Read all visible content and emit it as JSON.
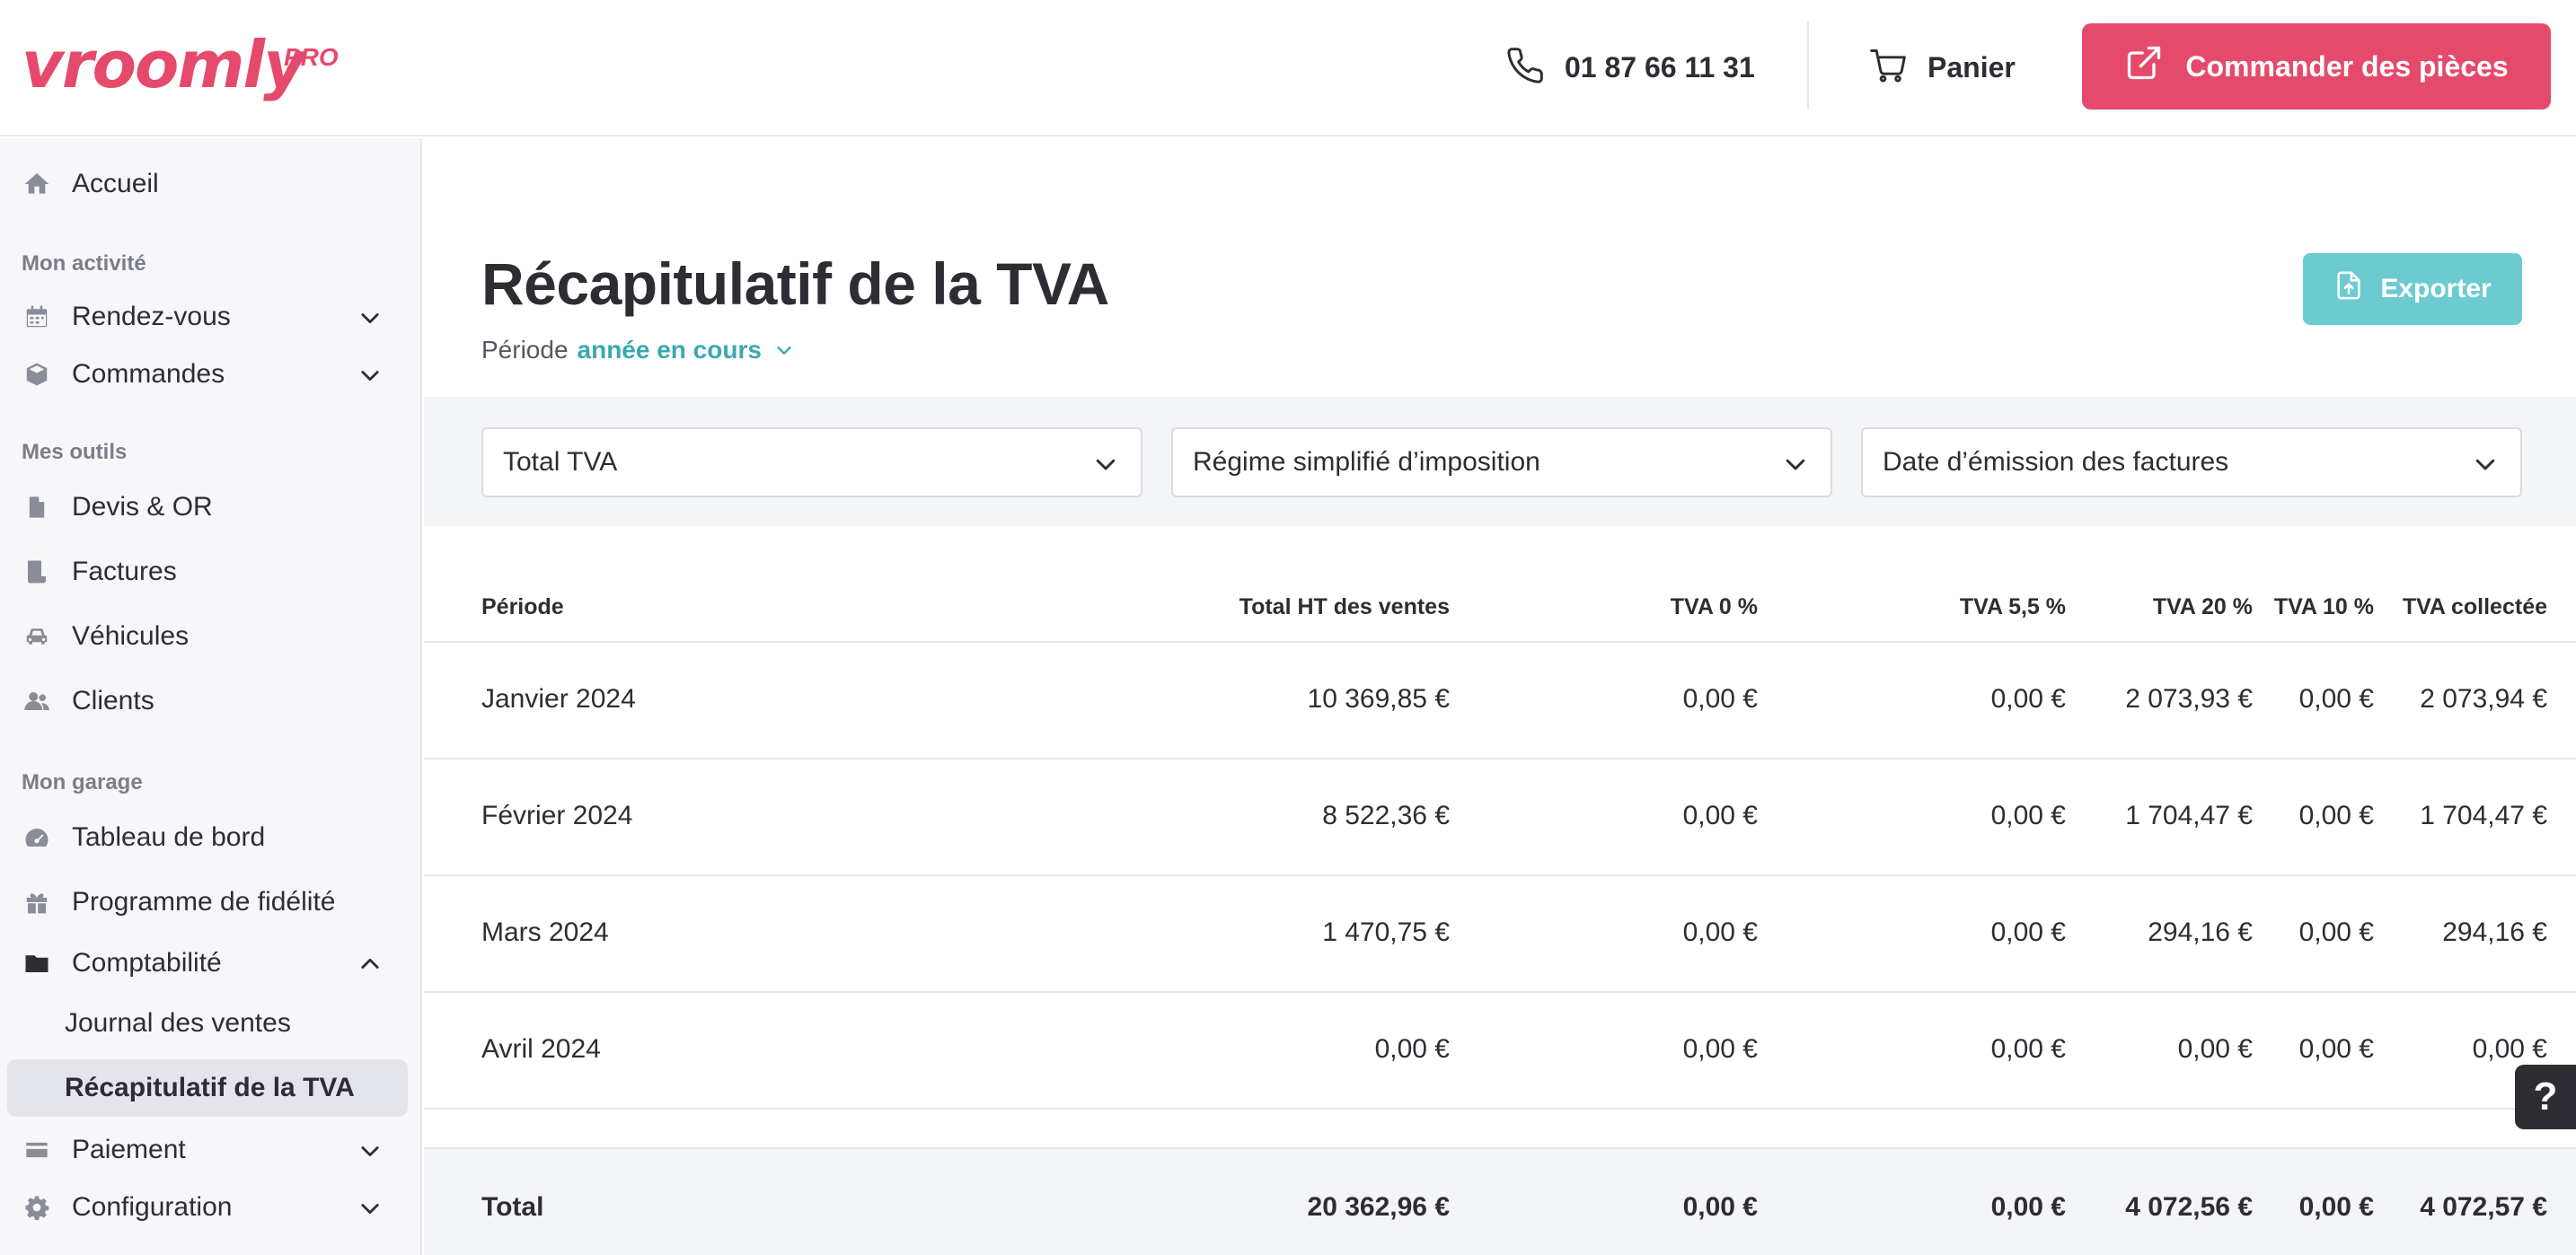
{
  "header": {
    "logo": "vroomly",
    "logo_suffix": "PRO",
    "phone": "01 87 66 11 31",
    "cart": "Panier",
    "order_button": "Commander des pièces"
  },
  "sidebar": {
    "home": "Accueil",
    "section_activity": "Mon activité",
    "appointments": "Rendez-vous",
    "orders": "Commandes",
    "section_tools": "Mes outils",
    "quotes": "Devis & OR",
    "invoices": "Factures",
    "vehicles": "Véhicules",
    "clients": "Clients",
    "section_garage": "Mon garage",
    "dashboard": "Tableau de bord",
    "loyalty": "Programme de fidélité",
    "accounting": "Comptabilité",
    "sales_journal": "Journal des ventes",
    "vat_summary": "Récapitulatif de la TVA",
    "payment": "Paiement",
    "configuration": "Configuration"
  },
  "main": {
    "title": "Récapitulatif de la TVA",
    "period_label": "Période",
    "period_value": "année en cours",
    "export_button": "Exporter",
    "filters": [
      "Total TVA",
      "Régime simplifié d’imposition",
      "Date d’émission des factures"
    ]
  },
  "table": {
    "headers": [
      "Période",
      "Total HT des ventes",
      "TVA 0 %",
      "TVA 5,5 %",
      "TVA 10 %",
      "TVA 20 %",
      "TVA collectée"
    ],
    "rows": [
      [
        "Janvier 2024",
        "10 369,85 €",
        "0,00 €",
        "0,00 €",
        "0,00 €",
        "2 073,93 €",
        "2 073,94 €"
      ],
      [
        "Février 2024",
        "8 522,36 €",
        "0,00 €",
        "0,00 €",
        "0,00 €",
        "1 704,47 €",
        "1 704,47 €"
      ],
      [
        "Mars 2024",
        "1 470,75 €",
        "0,00 €",
        "0,00 €",
        "0,00 €",
        "294,16 €",
        "294,16 €"
      ],
      [
        "Avril 2024",
        "0,00 €",
        "0,00 €",
        "0,00 €",
        "0,00 €",
        "0,00 €",
        "0,00 €"
      ]
    ],
    "total": [
      "Total",
      "20 362,96 €",
      "0,00 €",
      "0,00 €",
      "0,00 €",
      "4 072,56 €",
      "4 072,57 €"
    ]
  },
  "help_label": "?",
  "colors": {
    "brand": "#e54a6c",
    "accent": "#3aa8b2",
    "export": "#6ccbd1"
  }
}
